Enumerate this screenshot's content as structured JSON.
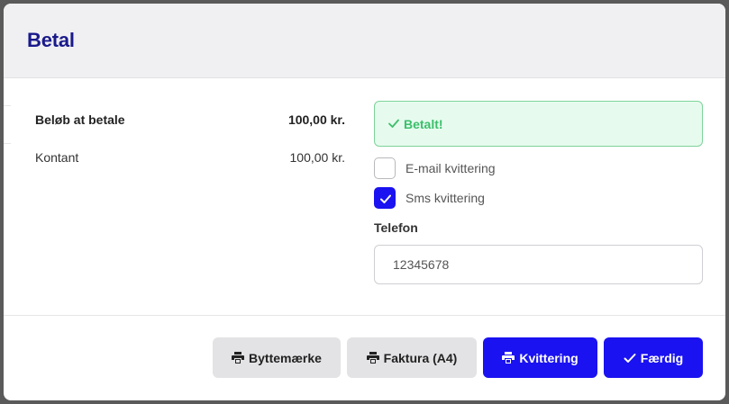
{
  "modal": {
    "title": "Betal"
  },
  "payment": {
    "total_label": "Beløb at betale",
    "total_value": "100,00 kr.",
    "method_label": "Kontant",
    "method_value": "100,00 kr."
  },
  "status": {
    "paid_text": "Betalt!",
    "icon": "check-icon",
    "color": "#3cbf6b"
  },
  "receipt_options": {
    "email_label": "E-mail kvittering",
    "email_checked": false,
    "sms_label": "Sms kvittering",
    "sms_checked": true
  },
  "phone": {
    "label": "Telefon",
    "value": "12345678"
  },
  "footer": {
    "buttons": [
      {
        "label": "Byttemærke",
        "icon": "printer-icon",
        "style": "secondary"
      },
      {
        "label": "Faktura (A4)",
        "icon": "printer-icon",
        "style": "secondary"
      },
      {
        "label": "Kvittering",
        "icon": "printer-icon",
        "style": "primary"
      },
      {
        "label": "Færdig",
        "icon": "check-icon",
        "style": "primary"
      }
    ]
  },
  "colors": {
    "accent": "#1a12f0",
    "title": "#1a1a8c",
    "success_bg": "#e6fbee",
    "success_border": "#7fd39b"
  }
}
